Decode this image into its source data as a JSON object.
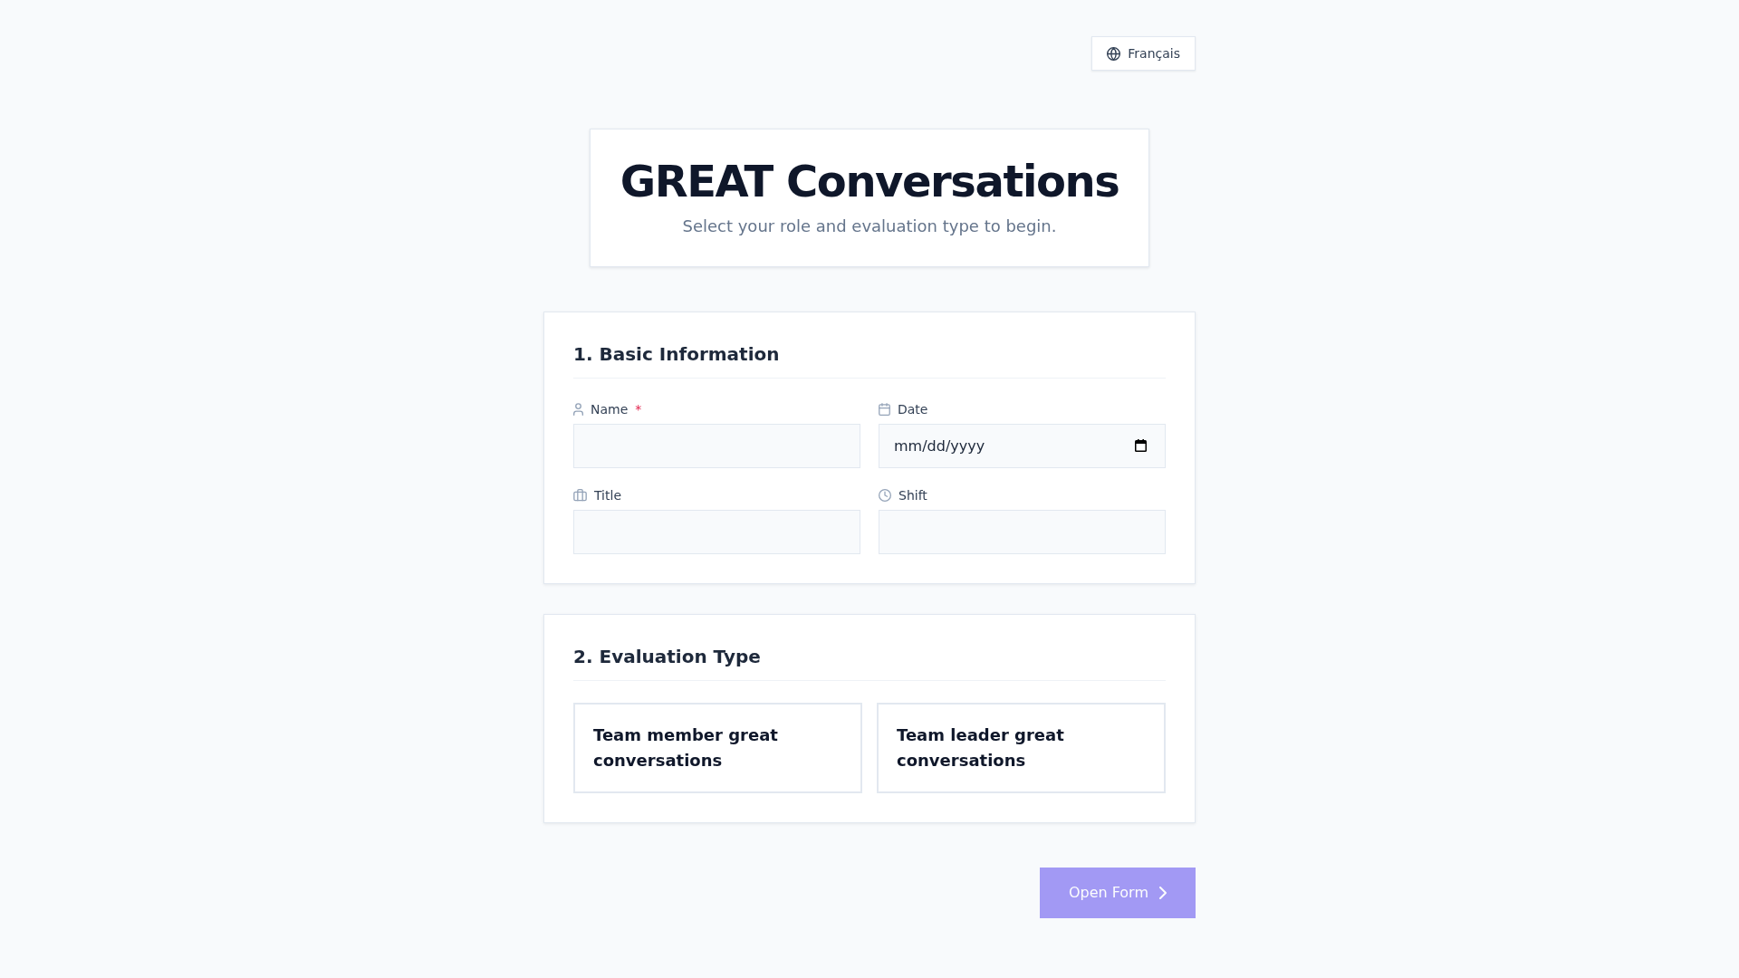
{
  "language_button": {
    "label": "Français"
  },
  "header": {
    "title": "GREAT Conversations",
    "subtitle": "Select your role and evaluation type to begin."
  },
  "basic_information": {
    "heading": "1. Basic Information",
    "fields": [
      {
        "kind": "text",
        "label": "Name",
        "required_mark": "*"
      },
      {
        "kind": "date",
        "label": "Date",
        "placeholder": "mm/dd/yyyy"
      },
      {
        "kind": "text",
        "label": "Title"
      },
      {
        "kind": "text",
        "label": "Shift"
      }
    ]
  },
  "evaluation_type": {
    "heading": "2. Evaluation Type",
    "options": [
      {
        "label": "Team member great conversations",
        "selected": false
      },
      {
        "label": "Team leader great conversations",
        "selected": false
      }
    ]
  },
  "open_form_button": {
    "label": "Open Form",
    "disabled": true
  }
}
